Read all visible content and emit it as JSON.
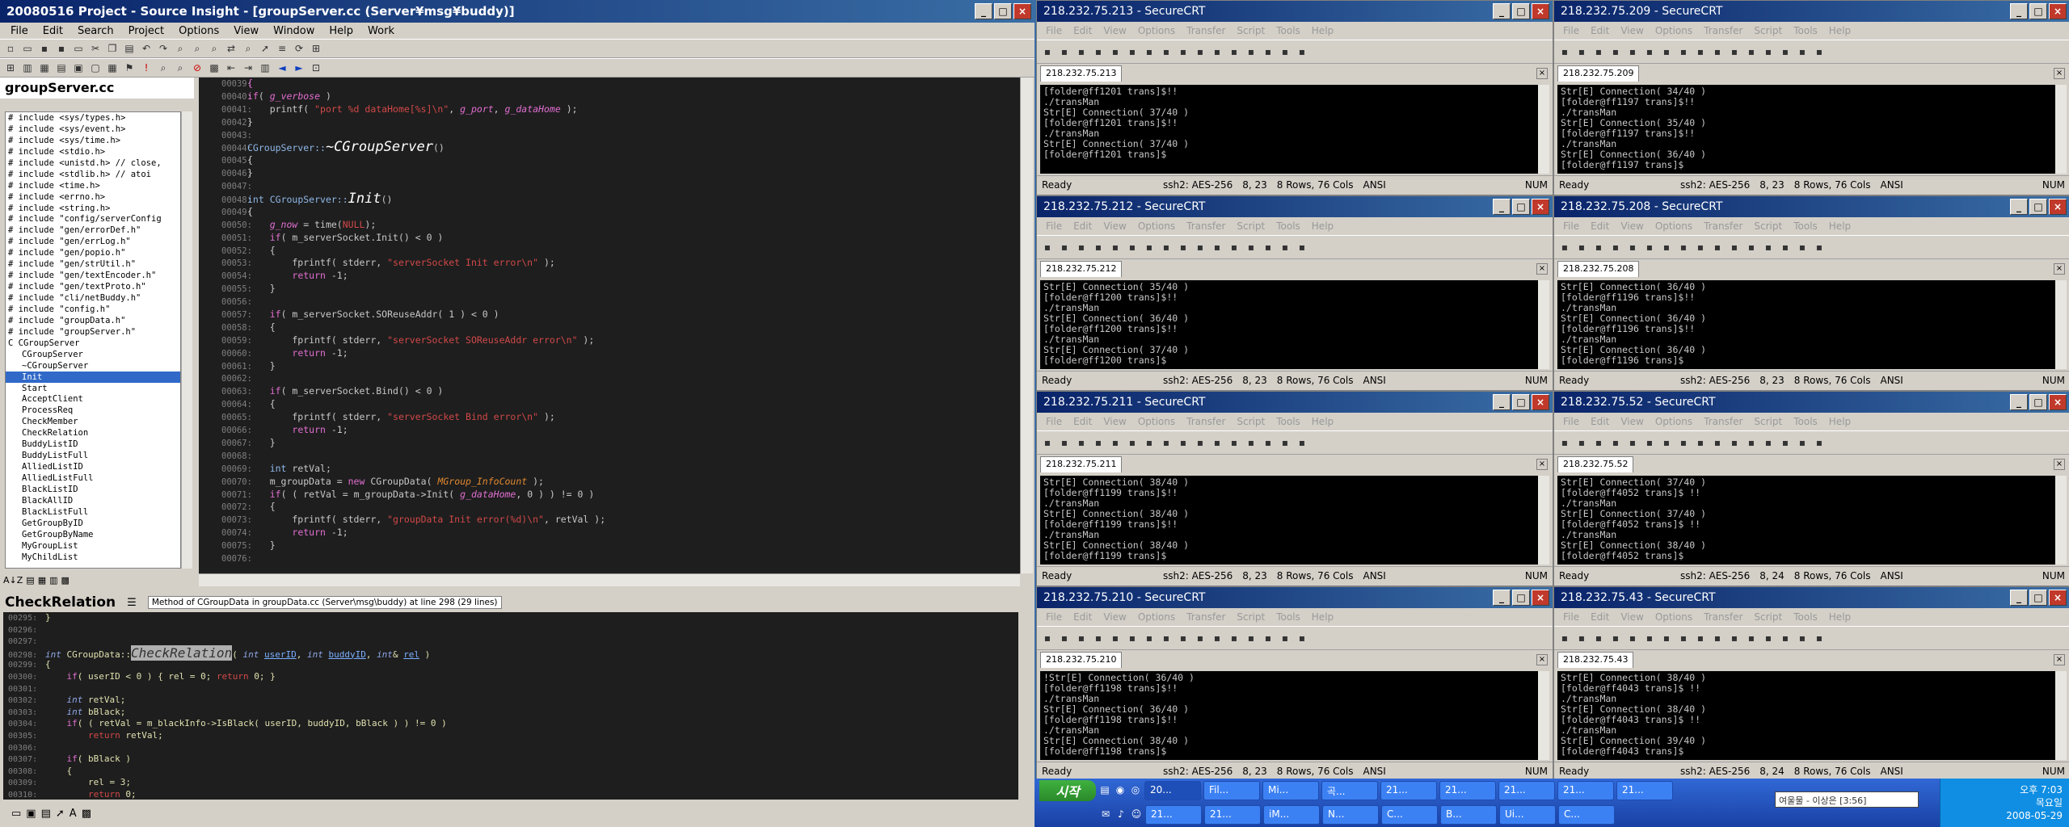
{
  "si": {
    "title": "20080516 Project - Source Insight - [groupServer.cc (Server¥msg¥buddy)]",
    "menu": [
      "File",
      "Edit",
      "Search",
      "Project",
      "Options",
      "View",
      "Window",
      "Help",
      "Work"
    ],
    "file_title": "groupServer.cc",
    "symbols": [
      {
        "t": "# include <sys/types.h>",
        "ind": false
      },
      {
        "t": "# include <sys/event.h>",
        "ind": false
      },
      {
        "t": "# include <sys/time.h>",
        "ind": false
      },
      {
        "t": "# include <stdio.h>",
        "ind": false
      },
      {
        "t": "# include <unistd.h> // close,",
        "ind": false
      },
      {
        "t": "# include <stdlib.h> // atoi",
        "ind": false
      },
      {
        "t": "# include <time.h>",
        "ind": false
      },
      {
        "t": "# include <errno.h>",
        "ind": false
      },
      {
        "t": "# include <string.h>",
        "ind": false
      },
      {
        "t": "# include \"config/serverConfig",
        "ind": false
      },
      {
        "t": "# include \"gen/errorDef.h\"",
        "ind": false
      },
      {
        "t": "# include \"gen/errLog.h\"",
        "ind": false
      },
      {
        "t": "# include \"gen/popio.h\"",
        "ind": false
      },
      {
        "t": "# include \"gen/strUtil.h\"",
        "ind": false
      },
      {
        "t": "# include \"gen/textEncoder.h\"",
        "ind": false
      },
      {
        "t": "# include \"gen/textProto.h\"",
        "ind": false
      },
      {
        "t": "# include \"cli/netBuddy.h\"",
        "ind": false
      },
      {
        "t": "# include \"config.h\"",
        "ind": false
      },
      {
        "t": "# include \"groupData.h\"",
        "ind": false
      },
      {
        "t": "# include \"groupServer.h\"",
        "ind": false
      },
      {
        "t": "C CGroupServer",
        "ind": false
      },
      {
        "t": "CGroupServer",
        "ind": true
      },
      {
        "t": "~CGroupServer",
        "ind": true
      },
      {
        "t": "Init",
        "ind": true,
        "sel": true
      },
      {
        "t": "Start",
        "ind": true
      },
      {
        "t": "AcceptClient",
        "ind": true
      },
      {
        "t": "ProcessReq",
        "ind": true
      },
      {
        "t": "CheckMember",
        "ind": true
      },
      {
        "t": "CheckRelation",
        "ind": true
      },
      {
        "t": "BuddyListID",
        "ind": true
      },
      {
        "t": "BuddyListFull",
        "ind": true
      },
      {
        "t": "AlliedListID",
        "ind": true
      },
      {
        "t": "AlliedListFull",
        "ind": true
      },
      {
        "t": "BlackListID",
        "ind": true
      },
      {
        "t": "BlackAllID",
        "ind": true
      },
      {
        "t": "BlackListFull",
        "ind": true
      },
      {
        "t": "GetGroupByID",
        "ind": true
      },
      {
        "t": "GetGroupByName",
        "ind": true
      },
      {
        "t": "MyGroupList",
        "ind": true
      },
      {
        "t": "MyChildList",
        "ind": true
      }
    ],
    "context_title": "CheckRelation",
    "context_desc": "Method of CGroupData in groupData.cc (Server\\msg\\buddy) at line 298 (29 lines)"
  },
  "code": [
    {
      "n": "00039:",
      "h": "<span class='kw'>{</span>"
    },
    {
      "n": "00040:",
      "h": "<span class='kw'>if</span>( <span class='gv'>g_verbose</span> )"
    },
    {
      "n": "00041:",
      "h": "    printf( <span class='str'>\"port %d dataHome[%s]\\n\"</span>, <span class='gv'>g_port</span>, <span class='gv'>g_dataHome</span> );"
    },
    {
      "n": "00042:",
      "h": "}"
    },
    {
      "n": "00043:",
      "h": ""
    },
    {
      "n": "00044:",
      "h": "<span class='cls'>CGroupServer::</span><span class='fn'>~CGroupServer</span>()"
    },
    {
      "n": "00045:",
      "h": "{"
    },
    {
      "n": "00046:",
      "h": "}"
    },
    {
      "n": "00047:",
      "h": ""
    },
    {
      "n": "00048:",
      "h": "<span class='cls'>int</span> <span class='cls'>CGroupServer::</span><span class='fn'>Init</span>()"
    },
    {
      "n": "00049:",
      "h": "{"
    },
    {
      "n": "00050:",
      "h": "    <span class='gv'>g_now</span> = time(<span class='str'>NULL</span>);"
    },
    {
      "n": "00051:",
      "h": "    <span class='kw'>if</span>( m_serverSocket.Init() &lt; 0 )"
    },
    {
      "n": "00052:",
      "h": "    {"
    },
    {
      "n": "00053:",
      "h": "        fprintf( stderr, <span class='str'>\"serverSocket Init error\\n\"</span> );"
    },
    {
      "n": "00054:",
      "h": "        <span class='kw'>return</span> -1;"
    },
    {
      "n": "00055:",
      "h": "    }"
    },
    {
      "n": "00056:",
      "h": ""
    },
    {
      "n": "00057:",
      "h": "    <span class='kw'>if</span>( m_serverSocket.SOReuseAddr( 1 ) &lt; 0 )"
    },
    {
      "n": "00058:",
      "h": "    {"
    },
    {
      "n": "00059:",
      "h": "        fprintf( stderr, <span class='str'>\"serverSocket SOReuseAddr error\\n\"</span> );"
    },
    {
      "n": "00060:",
      "h": "        <span class='kw'>return</span> -1;"
    },
    {
      "n": "00061:",
      "h": "    }"
    },
    {
      "n": "00062:",
      "h": ""
    },
    {
      "n": "00063:",
      "h": "    <span class='kw'>if</span>( m_serverSocket.Bind() &lt; 0 )"
    },
    {
      "n": "00064:",
      "h": "    {"
    },
    {
      "n": "00065:",
      "h": "        fprintf( stderr, <span class='str'>\"serverSocket Bind error\\n\"</span> );"
    },
    {
      "n": "00066:",
      "h": "        <span class='kw'>return</span> -1;"
    },
    {
      "n": "00067:",
      "h": "    }"
    },
    {
      "n": "00068:",
      "h": ""
    },
    {
      "n": "00069:",
      "h": "    <span class='cls'>int</span> retVal;"
    },
    {
      "n": "00070:",
      "h": "    m_groupData = <span class='kw'>new</span> CGroupData( <span class='mac'>MGroup_InfoCount</span> );"
    },
    {
      "n": "00071:",
      "h": "    <span class='kw'>if</span>( ( retVal = m_groupData-&gt;Init( <span class='gv'>g_dataHome</span>, 0 ) ) != 0 )"
    },
    {
      "n": "00072:",
      "h": "    {"
    },
    {
      "n": "00073:",
      "h": "        fprintf( stderr, <span class='str'>\"groupData Init error(%d)\\n\"</span>, retVal );"
    },
    {
      "n": "00074:",
      "h": "        <span class='kw'>return</span> -1;"
    },
    {
      "n": "00075:",
      "h": "    }"
    },
    {
      "n": "00076:",
      "h": ""
    }
  ],
  "ctx_code": [
    {
      "n": "00295:",
      "h": "}"
    },
    {
      "n": "00296:",
      "h": ""
    },
    {
      "n": "00297:",
      "h": ""
    },
    {
      "n": "00298:",
      "h": "<span class='ty'>int</span> CGroupData::<span class='hl'>CheckRelation</span>( <span class='ty'>int</span> <span class='u'>userID</span>, <span class='ty'>int</span> <span class='u'>buddyID</span>, <span class='ty'>int</span>&amp; <span class='u'>rel</span> )"
    },
    {
      "n": "00299:",
      "h": "{"
    },
    {
      "n": "00300:",
      "h": "    <span class='kw'>if</span>( userID &lt; 0 ) { rel = 0; <span class='red'>return</span> 0; }"
    },
    {
      "n": "00301:",
      "h": ""
    },
    {
      "n": "00302:",
      "h": "    <span class='ty'>int</span> retVal;"
    },
    {
      "n": "00303:",
      "h": "    <span class='ty'>int</span> bBlack;"
    },
    {
      "n": "00304:",
      "h": "    <span class='kw'>if</span>( ( retVal = m_blackInfo-&gt;IsBlack( userID, buddyID, bBlack ) ) != 0 )"
    },
    {
      "n": "00305:",
      "h": "        <span class='red'>return</span> retVal;"
    },
    {
      "n": "00306:",
      "h": ""
    },
    {
      "n": "00307:",
      "h": "    <span class='kw'>if</span>( bBlack )"
    },
    {
      "n": "00308:",
      "h": "    {"
    },
    {
      "n": "00309:",
      "h": "        rel = 3;"
    },
    {
      "n": "00310:",
      "h": "        <span class='red'>return</span> 0;"
    }
  ],
  "crt": {
    "menu": [
      "File",
      "Edit",
      "View",
      "Options",
      "Transfer",
      "Script",
      "Tools",
      "Help"
    ],
    "sessions": [
      {
        "title": "218.232.75.213 - SecureCRT",
        "tab": "218.232.75.213",
        "text": "[folder@ff1201 trans]$!!\n./transMan\nStr[E] Connection( 37/40 )\n[folder@ff1201 trans]$!!\n./transMan\nStr[E] Connection( 37/40 )\n[folder@ff1201 trans]$",
        "pos": "8, 23"
      },
      {
        "title": "218.232.75.209 - SecureCRT",
        "tab": "218.232.75.209",
        "text": "Str[E] Connection( 34/40 )\n[folder@ff1197 trans]$!!\n./transMan\nStr[E] Connection( 35/40 )\n[folder@ff1197 trans]$!!\n./transMan\nStr[E] Connection( 36/40 )\n[folder@ff1197 trans]$",
        "pos": "8, 23"
      },
      {
        "title": "218.232.75.212 - SecureCRT",
        "tab": "218.232.75.212",
        "text": "Str[E] Connection( 35/40 )\n[folder@ff1200 trans]$!!\n./transMan\nStr[E] Connection( 36/40 )\n[folder@ff1200 trans]$!!\n./transMan\nStr[E] Connection( 37/40 )\n[folder@ff1200 trans]$",
        "pos": "8, 23"
      },
      {
        "title": "218.232.75.208 - SecureCRT",
        "tab": "218.232.75.208",
        "text": "Str[E] Connection( 36/40 )\n[folder@ff1196 trans]$!!\n./transMan\nStr[E] Connection( 36/40 )\n[folder@ff1196 trans]$!!\n./transMan\nStr[E] Connection( 36/40 )\n[folder@ff1196 trans]$",
        "pos": "8, 23"
      },
      {
        "title": "218.232.75.211 - SecureCRT",
        "tab": "218.232.75.211",
        "text": "Str[E] Connection( 38/40 )\n[folder@ff1199 trans]$!!\n./transMan\nStr[E] Connection( 38/40 )\n[folder@ff1199 trans]$!!\n./transMan\nStr[E] Connection( 38/40 )\n[folder@ff1199 trans]$",
        "pos": "8, 23"
      },
      {
        "title": "218.232.75.52 - SecureCRT",
        "tab": "218.232.75.52",
        "text": "Str[E] Connection( 37/40 )\n[folder@ff4052 trans]$ !!\n./transMan\nStr[E] Connection( 37/40 )\n[folder@ff4052 trans]$ !!\n./transMan\nStr[E] Connection( 38/40 )\n[folder@ff4052 trans]$",
        "pos": "8, 24"
      },
      {
        "title": "218.232.75.210 - SecureCRT",
        "tab": "218.232.75.210",
        "text": "!Str[E] Connection( 36/40 )\n[folder@ff1198 trans]$!!\n./transMan\nStr[E] Connection( 36/40 )\n[folder@ff1198 trans]$!!\n./transMan\nStr[E] Connection( 38/40 )\n[folder@ff1198 trans]$",
        "pos": "8, 23"
      },
      {
        "title": "218.232.75.43 - SecureCRT",
        "tab": "218.232.75.43",
        "text": "Str[E] Connection( 38/40 )\n[folder@ff4043 trans]$ !!\n./transMan\nStr[E] Connection( 38/40 )\n[folder@ff4043 trans]$ !!\n./transMan\nStr[E] Connection( 39/40 )\n[folder@ff4043 trans]$",
        "pos": "8, 24"
      }
    ],
    "status_ready": "Ready",
    "status_cipher": "ssh2: AES-256",
    "status_rows": "8 Rows,  76 Cols",
    "status_enc": "ANSI",
    "status_num": "NUM"
  },
  "taskbar": {
    "start": "시작",
    "row1": [
      "20...",
      "Fil...",
      "Mi...",
      "곡...",
      "21...",
      "21...",
      "21...",
      "21...",
      "21..."
    ],
    "row2": [
      "21...",
      "21...",
      "iM...",
      "N...",
      "C...",
      "B...",
      "Ui...",
      "C..."
    ],
    "ime": "여울물 - 이상은 [3:56]",
    "time": "오후 7:03",
    "day": "목요일",
    "date": "2008-05-29"
  }
}
